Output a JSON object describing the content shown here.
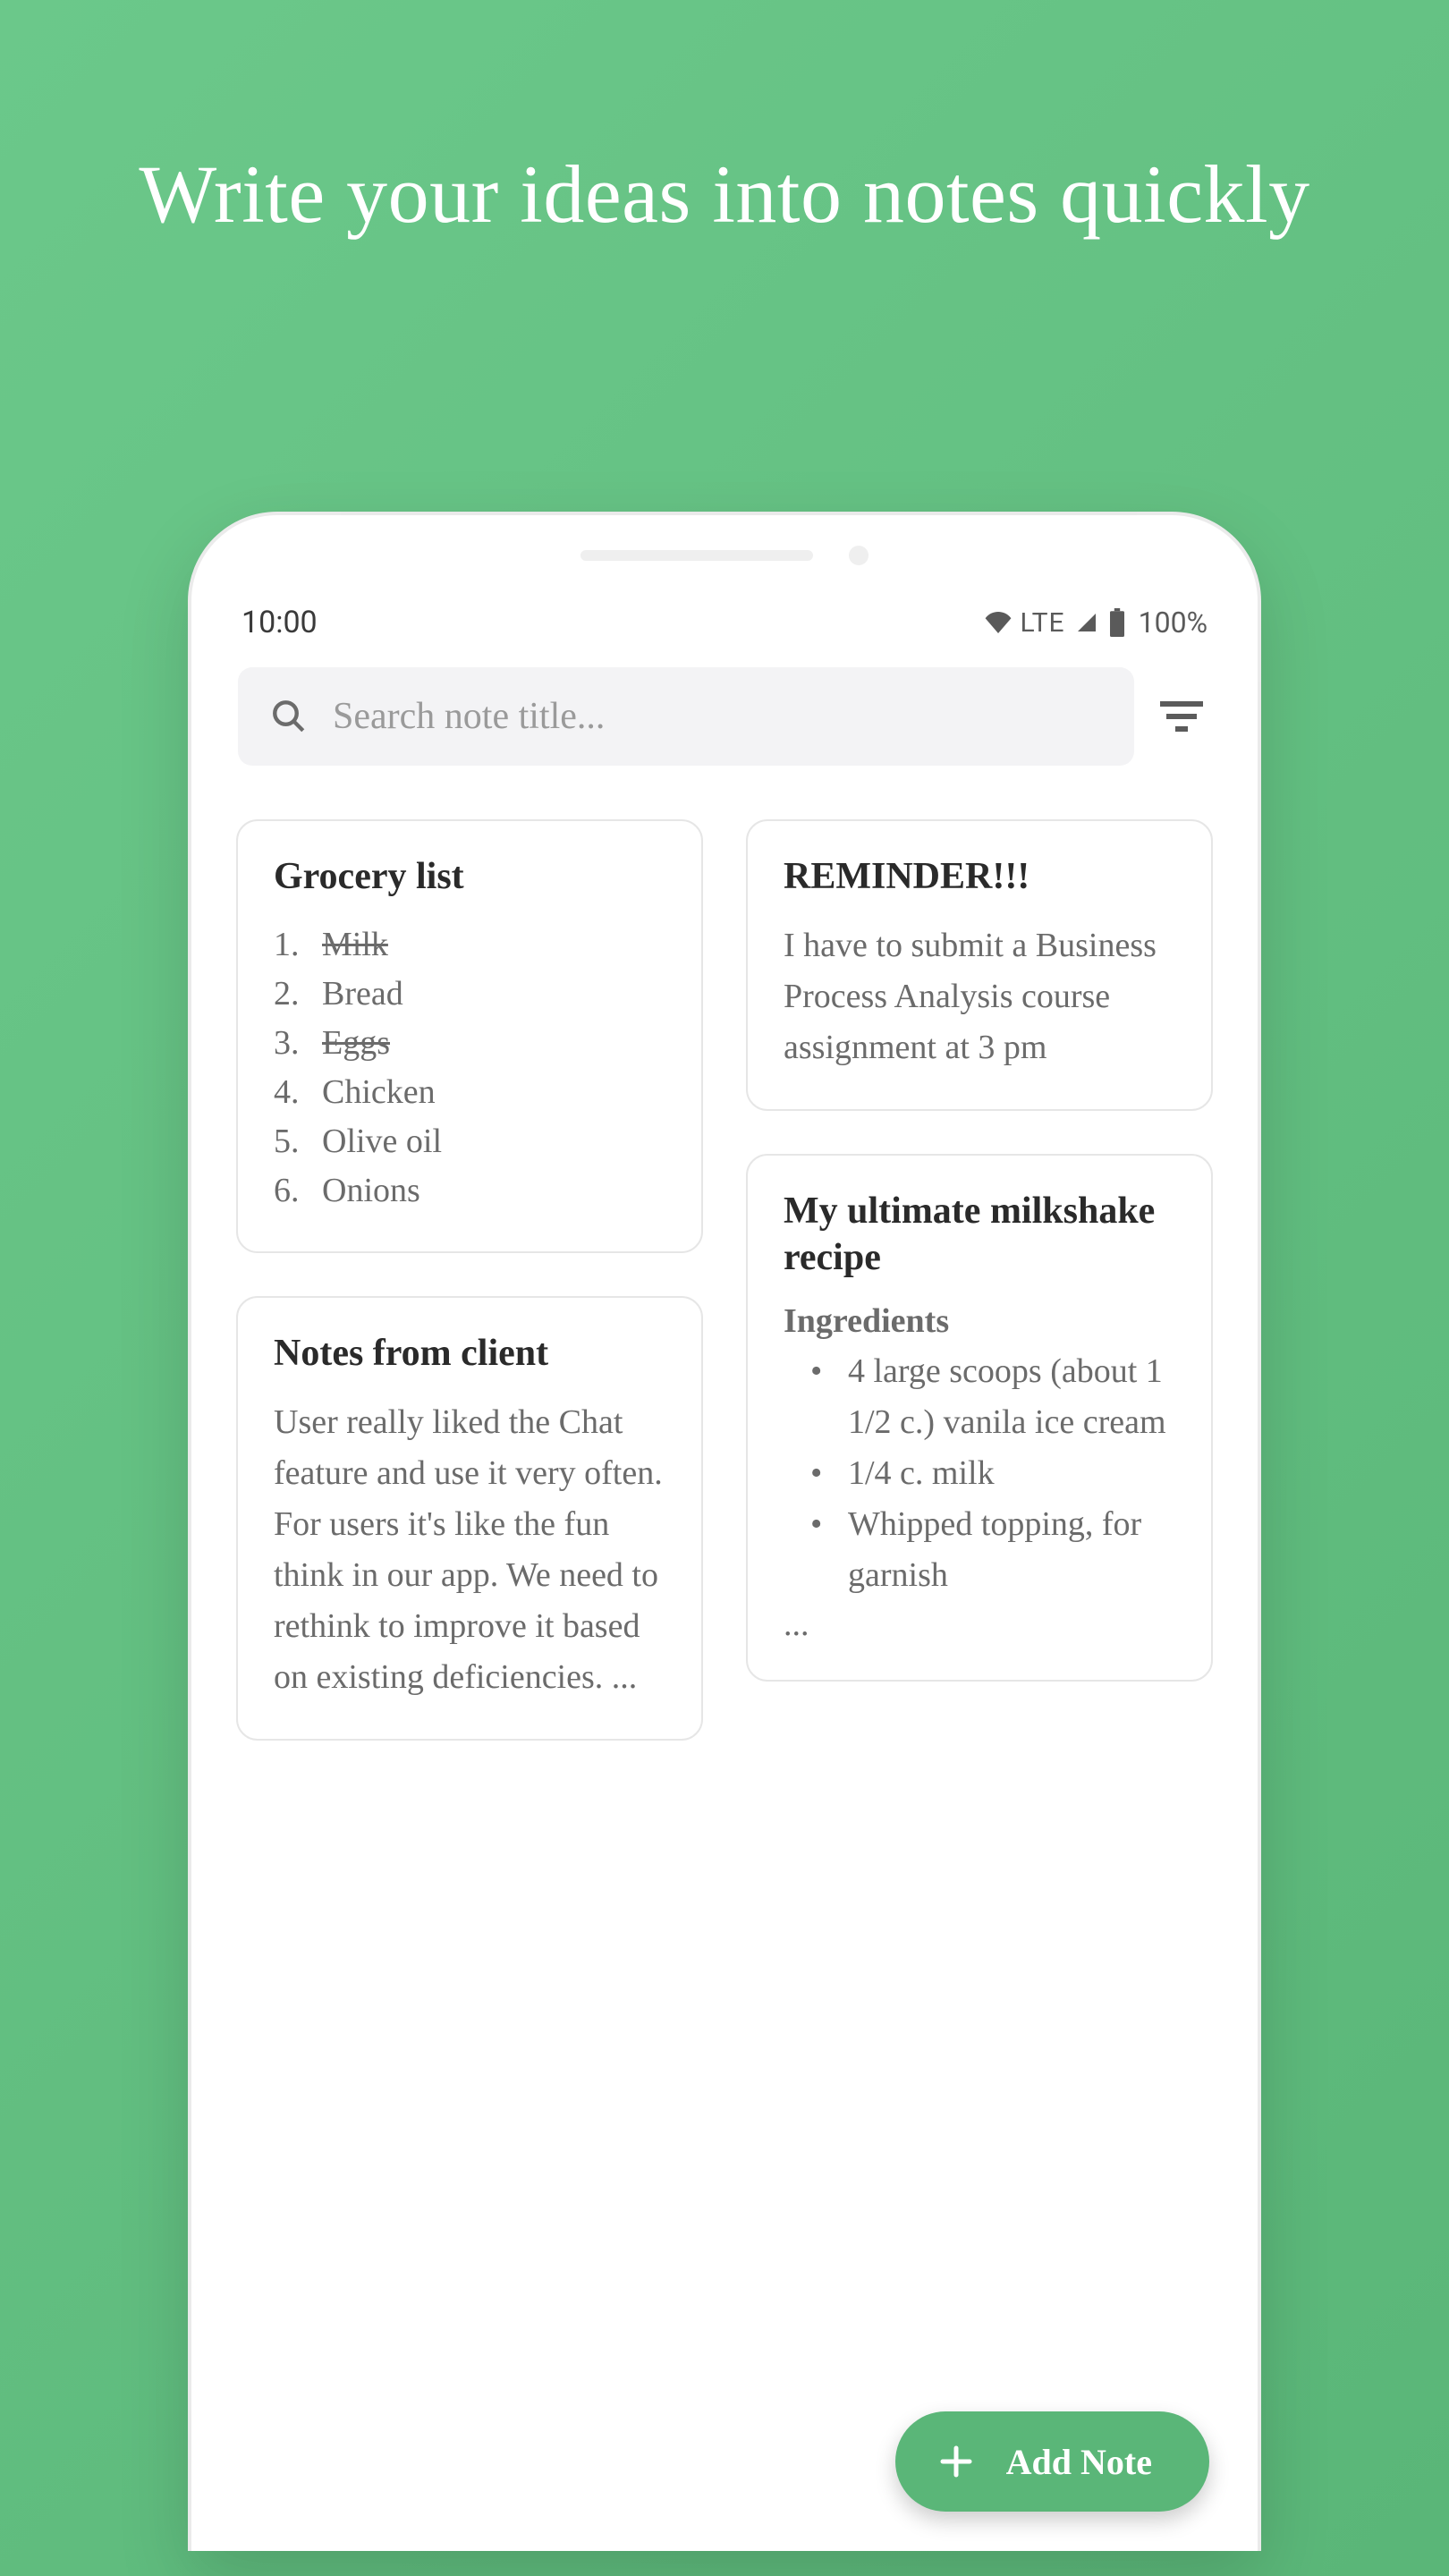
{
  "headline": "Write your ideas into notes quickly",
  "status": {
    "time": "10:00",
    "network": "LTE",
    "battery": "100%"
  },
  "search": {
    "placeholder": "Search note title..."
  },
  "notes": {
    "grocery": {
      "title": "Grocery list",
      "items": [
        {
          "n": "1.",
          "text": "Milk",
          "done": true
        },
        {
          "n": "2.",
          "text": "Bread",
          "done": false
        },
        {
          "n": "3.",
          "text": "Eggs",
          "done": true
        },
        {
          "n": "4.",
          "text": "Chicken",
          "done": false
        },
        {
          "n": "5.",
          "text": "Olive oil",
          "done": false
        },
        {
          "n": "6.",
          "text": "Onions",
          "done": false
        }
      ]
    },
    "reminder": {
      "title": "REMINDER!!!",
      "body": "I have to submit a Business Process Analysis course assignment at 3 pm"
    },
    "client": {
      "title": "Notes from client",
      "body": "User really liked the Chat feature and use it very often. For users it's like the fun think in our app. We need to rethink to improve it based on existing deficiencies. ..."
    },
    "recipe": {
      "title": "My ultimate milkshake recipe",
      "subhead": "Ingredients",
      "bullets": [
        "4 large scoops (about 1 1/2 c.) vanila ice cream",
        "1/4 c. milk",
        "Whipped topping, for garnish"
      ],
      "ellipsis": "..."
    }
  },
  "fab": {
    "label": "Add Note"
  }
}
